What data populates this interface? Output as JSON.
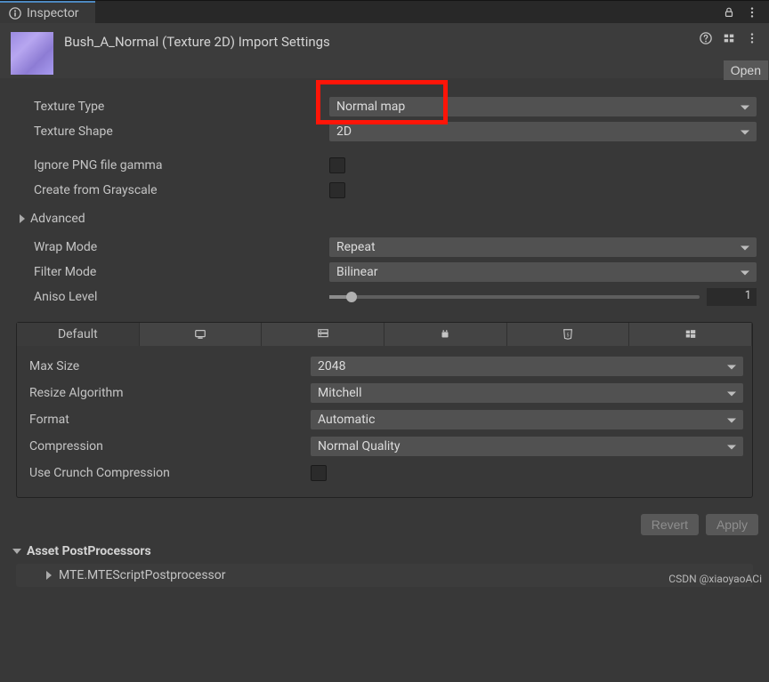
{
  "tab": {
    "title": "Inspector"
  },
  "header": {
    "title": "Bush_A_Normal (Texture 2D) Import Settings",
    "open": "Open"
  },
  "fields": {
    "textureType": {
      "label": "Texture Type",
      "value": "Normal map"
    },
    "textureShape": {
      "label": "Texture Shape",
      "value": "2D"
    },
    "ignorePngGamma": {
      "label": "Ignore PNG file gamma"
    },
    "createFromGrayscale": {
      "label": "Create from Grayscale"
    },
    "advanced": {
      "label": "Advanced"
    },
    "wrapMode": {
      "label": "Wrap Mode",
      "value": "Repeat"
    },
    "filterMode": {
      "label": "Filter Mode",
      "value": "Bilinear"
    },
    "anisoLevel": {
      "label": "Aniso Level",
      "value": "1"
    }
  },
  "platformTabs": {
    "default": "Default"
  },
  "platform": {
    "maxSize": {
      "label": "Max Size",
      "value": "2048"
    },
    "resizeAlgorithm": {
      "label": "Resize Algorithm",
      "value": "Mitchell"
    },
    "format": {
      "label": "Format",
      "value": "Automatic"
    },
    "compression": {
      "label": "Compression",
      "value": "Normal Quality"
    },
    "useCrunch": {
      "label": "Use Crunch Compression"
    }
  },
  "footer": {
    "revert": "Revert",
    "apply": "Apply"
  },
  "postproc": {
    "header": "Asset PostProcessors",
    "item": "MTE.MTEScriptPostprocessor"
  },
  "watermark": "CSDN @xiaoyaoACi"
}
